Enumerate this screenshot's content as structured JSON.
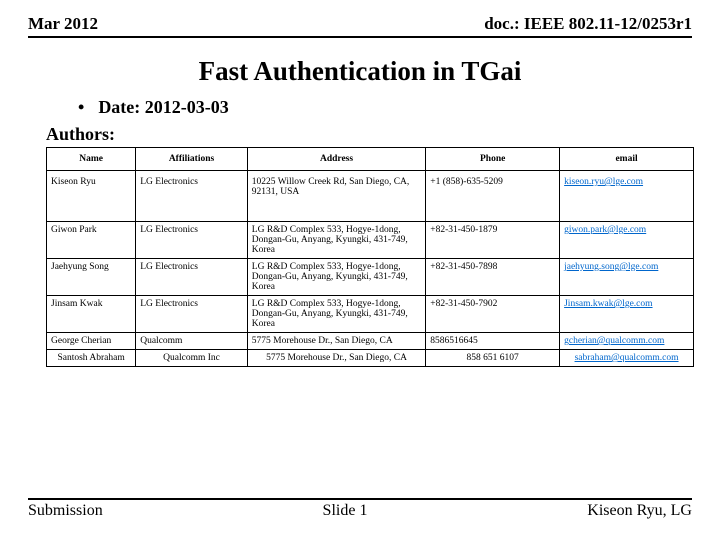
{
  "header": {
    "left": "Mar 2012",
    "right": "doc.: IEEE 802.11-12/0253r1"
  },
  "title": "Fast Authentication in TGai",
  "date_label": "Date: 2012-03-03",
  "authors_label": "Authors:",
  "table": {
    "headers": [
      "Name",
      "Affiliations",
      "Address",
      "Phone",
      "email"
    ],
    "rows": [
      {
        "name": "Kiseon Ryu",
        "aff": "LG Electronics",
        "addr": "10225 Willow Creek Rd, San Diego, CA, 92131, USA",
        "phone": "+1 (858)-635-5209",
        "email": "kiseon.ryu@lge.com"
      },
      {
        "name": "Giwon Park",
        "aff": "LG Electronics",
        "addr": "LG R&D Complex 533, Hogye-1dong, Dongan-Gu, Anyang, Kyungki, 431-749, Korea",
        "phone": "+82-31-450-1879",
        "email": "giwon.park@lge.com"
      },
      {
        "name": "Jaehyung Song",
        "aff": "LG Electronics",
        "addr": "LG R&D Complex 533, Hogye-1dong, Dongan-Gu, Anyang, Kyungki, 431-749, Korea",
        "phone": "+82-31-450-7898",
        "email": "jaehyung.song@lge.com"
      },
      {
        "name": "Jinsam Kwak",
        "aff": "LG Electronics",
        "addr": "LG R&D Complex 533, Hogye-1dong, Dongan-Gu, Anyang, Kyungki, 431-749, Korea",
        "phone": "+82-31-450-7902",
        "email": "Jinsam.kwak@lge.com"
      },
      {
        "name": "George Cherian",
        "aff": "Qualcomm",
        "addr": "5775 Morehouse Dr., San Diego, CA",
        "phone": "8586516645",
        "email": "gcherian@qualcomm.com"
      },
      {
        "name": "Santosh Abraham",
        "aff": "Qualcomm Inc",
        "addr": "5775 Morehouse Dr., San Diego, CA",
        "phone": "858 651 6107",
        "email": "sabraham@qualcomm.com"
      }
    ]
  },
  "footer": {
    "left": "Submission",
    "center": "Slide 1",
    "right": "Kiseon Ryu, LG"
  }
}
